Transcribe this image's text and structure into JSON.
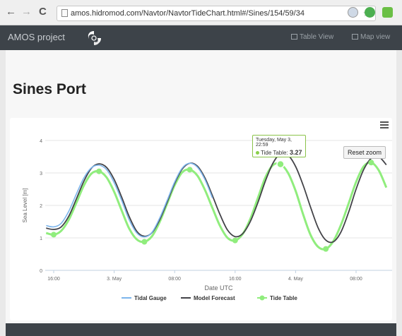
{
  "browser": {
    "url": "amos.hidromod.com/Navtor/NavtorTideChart.html#/Sines/154/59/34",
    "back": "←",
    "forward": "→",
    "reload": "C",
    "star": "☆"
  },
  "app": {
    "brand": "AMOS project",
    "nav_table": "Table View",
    "nav_map": "Map view"
  },
  "page": {
    "title": "Sines Port"
  },
  "chart": {
    "reset_zoom": "Reset zoom",
    "tooltip": {
      "date": "Tuesday, May 3, 22:59",
      "series": "Tide Table:",
      "value": "3.27"
    }
  },
  "chart_data": {
    "type": "line",
    "title": "",
    "xlabel": "Date UTC",
    "ylabel": "Sea Level [m]",
    "ylim": [
      0,
      4
    ],
    "yticks": [
      0,
      1,
      2,
      3,
      4
    ],
    "x_unit": "hours from 2 May 16:00",
    "xlim": [
      0,
      50
    ],
    "xticks": [
      {
        "x": 0,
        "label": "16:00"
      },
      {
        "x": 8,
        "label": "3. May"
      },
      {
        "x": 16,
        "label": "08:00"
      },
      {
        "x": 24,
        "label": "16:00"
      },
      {
        "x": 32,
        "label": "4. May"
      },
      {
        "x": 40,
        "label": "08:00"
      }
    ],
    "grid": true,
    "legend_position": "bottom-center",
    "series": [
      {
        "name": "Tidal Gauge",
        "color": "#7cb5ec",
        "points": [
          [
            -1,
            1.38
          ],
          [
            0,
            1.34
          ],
          [
            1,
            1.45
          ],
          [
            2,
            1.82
          ],
          [
            3,
            2.35
          ],
          [
            4,
            2.85
          ],
          [
            5,
            3.16
          ],
          [
            6,
            3.24
          ],
          [
            7,
            3.1
          ],
          [
            8,
            2.7
          ],
          [
            9,
            2.15
          ],
          [
            10,
            1.55
          ],
          [
            11,
            1.15
          ],
          [
            12,
            1.03
          ],
          [
            13,
            1.17
          ],
          [
            14,
            1.6
          ],
          [
            15,
            2.15
          ],
          [
            16,
            2.72
          ],
          [
            17,
            3.15
          ],
          [
            18,
            3.3
          ],
          [
            19,
            3.18
          ],
          [
            20,
            2.8
          ],
          [
            21,
            2.23
          ]
        ]
      },
      {
        "name": "Model Forecast",
        "color": "#434348",
        "points": [
          [
            -1,
            1.3
          ],
          [
            0,
            1.26
          ],
          [
            1,
            1.34
          ],
          [
            2,
            1.67
          ],
          [
            3,
            2.2
          ],
          [
            4,
            2.75
          ],
          [
            5,
            3.15
          ],
          [
            6,
            3.28
          ],
          [
            7,
            3.17
          ],
          [
            8,
            2.8
          ],
          [
            9,
            2.25
          ],
          [
            10,
            1.65
          ],
          [
            11,
            1.2
          ],
          [
            12,
            1.05
          ],
          [
            13,
            1.16
          ],
          [
            14,
            1.55
          ],
          [
            15,
            2.1
          ],
          [
            16,
            2.68
          ],
          [
            17,
            3.12
          ],
          [
            18,
            3.3
          ],
          [
            19,
            3.21
          ],
          [
            20,
            2.85
          ],
          [
            21,
            2.3
          ],
          [
            22,
            1.72
          ],
          [
            23,
            1.24
          ],
          [
            24,
            1.04
          ],
          [
            25,
            1.13
          ],
          [
            26,
            1.5
          ],
          [
            27,
            2.08
          ],
          [
            28,
            2.75
          ],
          [
            29,
            3.3
          ],
          [
            30,
            3.6
          ],
          [
            31,
            3.55
          ],
          [
            32,
            3.2
          ],
          [
            33,
            2.62
          ],
          [
            34,
            1.93
          ],
          [
            35,
            1.3
          ],
          [
            36,
            0.93
          ],
          [
            37,
            0.88
          ],
          [
            38,
            1.18
          ],
          [
            39,
            1.78
          ],
          [
            40,
            2.5
          ],
          [
            41,
            3.1
          ],
          [
            42,
            3.45
          ],
          [
            43,
            3.5
          ],
          [
            44,
            3.25
          ]
        ]
      },
      {
        "name": "Tide Table",
        "color": "#90ed7d",
        "points": [
          [
            -1,
            1.15
          ],
          [
            0,
            1.1
          ],
          [
            1,
            1.22
          ],
          [
            2,
            1.56
          ],
          [
            3,
            2.08
          ],
          [
            4,
            2.62
          ],
          [
            5,
            2.98
          ],
          [
            6,
            3.05
          ],
          [
            7,
            2.86
          ],
          [
            8,
            2.42
          ],
          [
            9,
            1.84
          ],
          [
            10,
            1.28
          ],
          [
            11,
            0.95
          ],
          [
            12,
            0.88
          ],
          [
            13,
            1.05
          ],
          [
            14,
            1.48
          ],
          [
            15,
            2.05
          ],
          [
            16,
            2.62
          ],
          [
            17,
            3.02
          ],
          [
            18,
            3.1
          ],
          [
            19,
            2.92
          ],
          [
            20,
            2.48
          ],
          [
            21,
            1.92
          ],
          [
            22,
            1.37
          ],
          [
            23,
            1.0
          ],
          [
            24,
            0.92
          ],
          [
            25,
            1.12
          ],
          [
            26,
            1.58
          ],
          [
            27,
            2.22
          ],
          [
            28,
            2.86
          ],
          [
            29,
            3.24
          ],
          [
            30,
            3.27
          ],
          [
            31,
            3.0
          ],
          [
            32,
            2.45
          ],
          [
            33,
            1.72
          ],
          [
            34,
            1.08
          ],
          [
            35,
            0.72
          ],
          [
            36,
            0.66
          ],
          [
            37,
            0.9
          ],
          [
            38,
            1.4
          ],
          [
            39,
            2.05
          ],
          [
            40,
            2.72
          ],
          [
            41,
            3.2
          ],
          [
            42,
            3.32
          ],
          [
            43,
            3.08
          ],
          [
            44,
            2.55
          ]
        ]
      }
    ],
    "markers": [
      {
        "series": "Tide Table",
        "points": [
          [
            0,
            1.1
          ],
          [
            6,
            3.05
          ],
          [
            12,
            0.88
          ],
          [
            18,
            3.1
          ],
          [
            24,
            0.92
          ],
          [
            30,
            3.27
          ],
          [
            36,
            0.66
          ],
          [
            42,
            3.32
          ]
        ]
      }
    ],
    "tooltip": {
      "series": "Tide Table",
      "x": 30,
      "y": 3.27,
      "label": "Tuesday, May 3, 22:59"
    }
  }
}
